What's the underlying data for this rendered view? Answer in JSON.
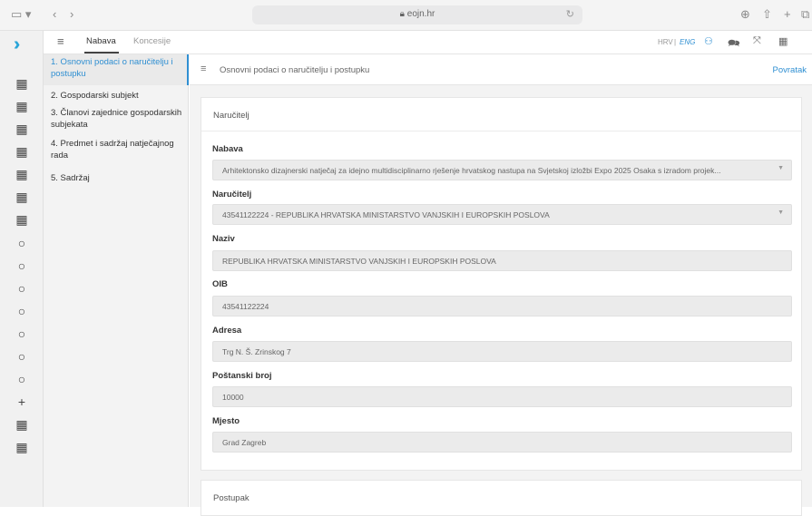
{
  "browser": {
    "url": "eojn.hr"
  },
  "appbar": {
    "tabs": [
      {
        "label": "Nabava"
      },
      {
        "label": "Koncesije"
      }
    ],
    "lang_hrv": "HRV",
    "lang_sep": "|",
    "lang_eng": "ENG"
  },
  "steps": [
    {
      "label": "1. Osnovni podaci o naručitelju i postupku"
    },
    {
      "label": "2. Gospodarski subjekt"
    },
    {
      "label": "3. Članovi zajednice gospodarskih subjekata"
    },
    {
      "label": "4. Predmet i sadržaj natječajnog rada"
    },
    {
      "label": "5. Sadržaj"
    }
  ],
  "crumb": {
    "title": "Osnovni podaci o naručitelju i postupku",
    "back": "Povratak"
  },
  "narucitelj": {
    "heading": "Naručitelj",
    "fields": [
      {
        "label": "Nabava",
        "value": "Arhitektonsko dizajnerski natječaj za idejno multidisciplinarno rješenje hrvatskog nastupa na Svjetskoj izložbi Expo 2025 Osaka s izradom projek..."
      },
      {
        "label": "Naručitelj",
        "value": "43541122224 - REPUBLIKA HRVATSKA MINISTARSTVO VANJSKIH I EUROPSKIH POSLOVA"
      },
      {
        "label": "Naziv",
        "value": "REPUBLIKA HRVATSKA MINISTARSTVO VANJSKIH I EUROPSKIH POSLOVA"
      },
      {
        "label": "OIB",
        "value": "43541122224"
      },
      {
        "label": "Adresa",
        "value": "Trg N. Š. Zrinskog 7"
      },
      {
        "label": "Poštanski broj",
        "value": "10000"
      },
      {
        "label": "Mjesto",
        "value": "Grad Zagreb"
      }
    ]
  },
  "postupak": {
    "heading": "Postupak"
  },
  "colors": {
    "accent": "#2f8fd2",
    "logo": "#2aa5d8"
  }
}
